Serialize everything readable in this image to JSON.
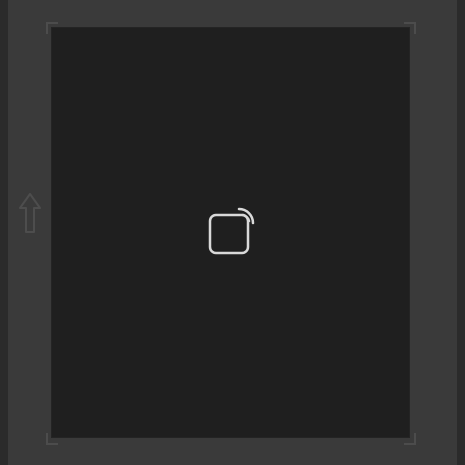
{
  "icons": {
    "side_arrow": "up-arrow-icon",
    "center": "camera-frame-icon"
  },
  "colors": {
    "background": "#3a3a3a",
    "viewport": "#1f1f1f",
    "icon_stroke": "#d9d9d9",
    "muted_stroke": "#4c4c4c"
  }
}
